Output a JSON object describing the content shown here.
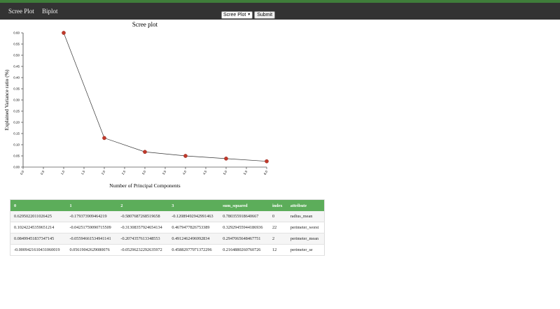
{
  "nav": {
    "links": [
      "Scree Plot",
      "Biplot"
    ],
    "select_value": "Scree Plot",
    "submit_label": "Submit"
  },
  "colors": {
    "navbar": "#333333",
    "accent": "#3f7d3a",
    "table_header": "#5cad5a",
    "point": "#c0392b"
  },
  "chart_data": {
    "type": "line",
    "title": "Scree plot",
    "xlabel": "Number of Principal Components",
    "ylabel": "Explained Variance ratio (%)",
    "x": [
      1,
      2,
      3,
      4,
      5,
      6
    ],
    "values": [
      0.6,
      0.13,
      0.068,
      0.05,
      0.038,
      0.026
    ],
    "xlim": [
      0,
      6
    ],
    "ylim": [
      0,
      0.6
    ],
    "xticks": [
      "0.0",
      "0.5",
      "1.0",
      "1.5",
      "2.0",
      "2.5",
      "3.0",
      "3.5",
      "4.0",
      "4.5",
      "5.0",
      "5.5",
      "6.0"
    ],
    "yticks": [
      "0.00",
      "0.05",
      "0.10",
      "0.15",
      "0.20",
      "0.25",
      "0.30",
      "0.35",
      "0.40",
      "0.45",
      "0.50",
      "0.55",
      "0.60"
    ],
    "grid": false
  },
  "table": {
    "columns": [
      "0",
      "1",
      "2",
      "3",
      "sum_squared",
      "index",
      "attribute"
    ],
    "rows": [
      [
        "0.6295022011026425",
        "-0.179373909464219",
        "-0.5807687268519658",
        "-0.12089492942991463",
        "0.780355918640667",
        "0",
        "radius_mean"
      ],
      [
        "0.10242245359651214",
        "-0.04251759090715509",
        "-0.31308357924654134",
        "0.4679477826753389",
        "0.32929455944186936",
        "22",
        "perimeter_worst"
      ],
      [
        "0.08499451837347145",
        "-0.05594661534941141",
        "-0.2074357613348553",
        "0.4912462496992834",
        "0.2947065648467751",
        "2",
        "perimeter_mean"
      ],
      [
        "-0.0009421610431060019",
        "0.05619042629080076",
        "-0.05296232292635972",
        "0.45882977971372296",
        "0.2164880260760726",
        "12",
        "perimeter_se"
      ]
    ]
  }
}
